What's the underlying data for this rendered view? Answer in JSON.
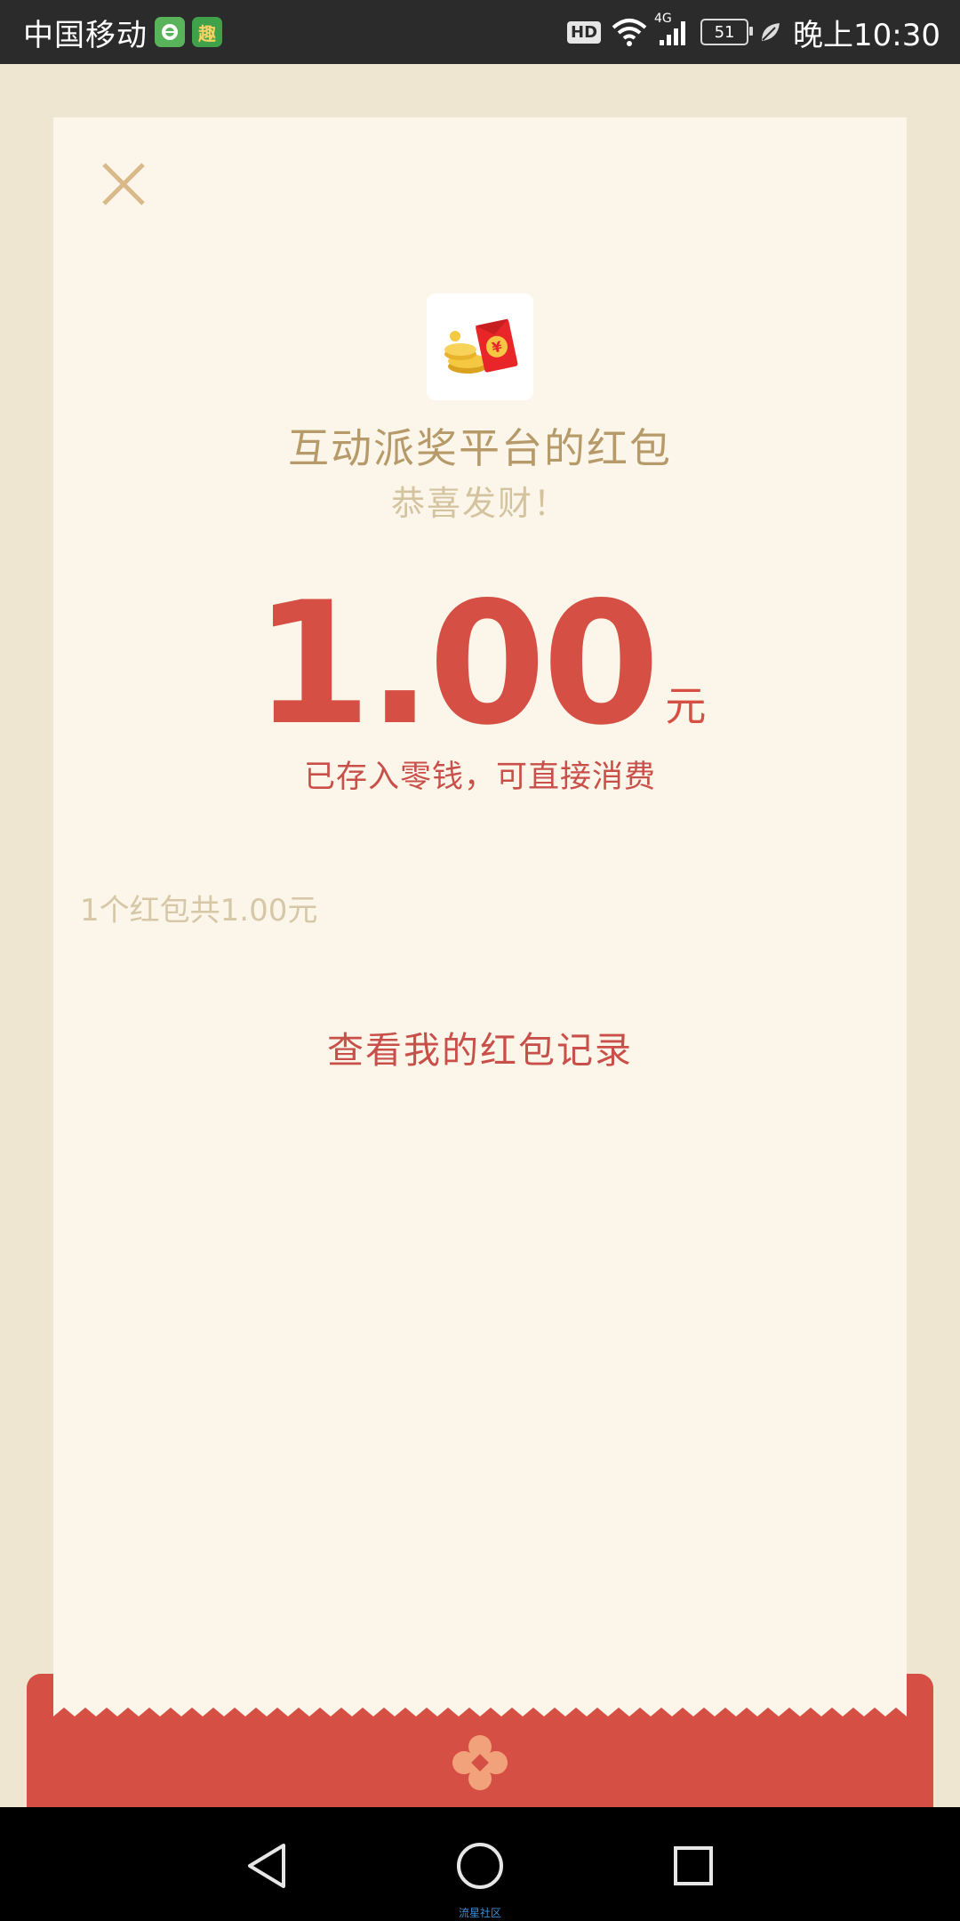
{
  "status_bar": {
    "carrier": "中国移动",
    "app_icon_2": "趣",
    "hd": "HD",
    "network": "4G",
    "battery": "51",
    "time": "晚上10:30"
  },
  "red_packet": {
    "sender": "互动派奖平台的红包",
    "greeting": "恭喜发财！",
    "amount": "1.00",
    "unit": "元",
    "note": "已存入零钱，可直接消费",
    "summary": "1个红包共1.00元",
    "records_link": "查看我的红包记录"
  },
  "nav_bar": {
    "watermark": "流星社区"
  },
  "colors": {
    "accent_red": "#d64f44",
    "gold": "#b79a6a",
    "card_bg": "#fbf6e9",
    "page_bg": "#efe6d2"
  },
  "icons": [
    "close-icon",
    "red-packet-logo-icon",
    "flower-icon",
    "back-icon",
    "home-icon",
    "recents-icon",
    "wifi-icon",
    "signal-icon",
    "battery-icon",
    "leaf-icon"
  ]
}
